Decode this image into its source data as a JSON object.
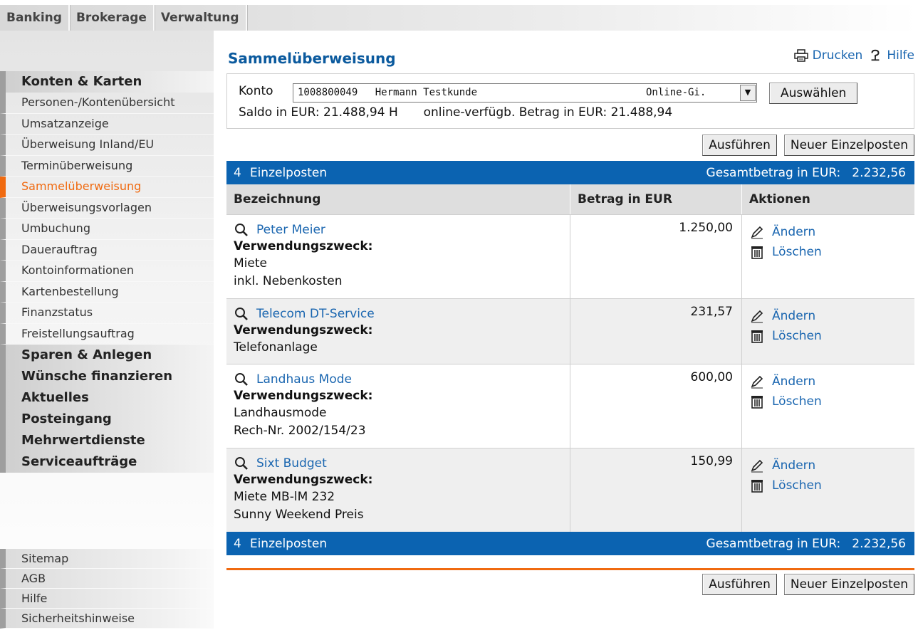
{
  "tabs": [
    {
      "label": "Banking"
    },
    {
      "label": "Brokerage"
    },
    {
      "label": "Verwaltung"
    }
  ],
  "sidebar": {
    "group1_title": "Konten & Karten",
    "items": [
      {
        "label": "Personen-/Kontenübersicht"
      },
      {
        "label": "Umsatzanzeige"
      },
      {
        "label": "Überweisung Inland/EU"
      },
      {
        "label": "Terminüberweisung"
      },
      {
        "label": "Sammelüberweisung"
      },
      {
        "label": "Überweisungsvorlagen"
      },
      {
        "label": "Umbuchung"
      },
      {
        "label": "Dauerauftrag"
      },
      {
        "label": "Kontoinformationen"
      },
      {
        "label": "Kartenbestellung"
      },
      {
        "label": "Finanzstatus"
      },
      {
        "label": "Freistellungsauftrag"
      }
    ],
    "groups": [
      {
        "label": "Sparen & Anlegen"
      },
      {
        "label": "Wünsche finanzieren"
      },
      {
        "label": "Aktuelles"
      },
      {
        "label": "Posteingang"
      },
      {
        "label": "Mehrwertdienste"
      },
      {
        "label": "Serviceaufträge"
      }
    ],
    "footer": [
      {
        "label": "Sitemap"
      },
      {
        "label": "AGB"
      },
      {
        "label": "Hilfe"
      },
      {
        "label": "Sicherheitshinweise"
      }
    ]
  },
  "page": {
    "title": "Sammelüberweisung",
    "print_label": "Drucken",
    "help_label": "Hilfe"
  },
  "konto": {
    "label": "Konto",
    "account_number": "1008800049",
    "account_holder": "Hermann Testkunde",
    "account_type": "Online-Gi.",
    "select_button": "Auswählen",
    "saldo_label": "Saldo in EUR:",
    "saldo_value": "21.488,94 H",
    "available_label": "online-verfügb. Betrag in EUR:",
    "available_value": "21.488,94"
  },
  "buttons": {
    "execute": "Ausführen",
    "new_item": "Neuer Einzelposten"
  },
  "summary": {
    "count": "4",
    "count_label": "Einzelposten",
    "total_label": "Gesamtbetrag in EUR:",
    "total_value": "2.232,56"
  },
  "table": {
    "headers": {
      "name": "Bezeichnung",
      "amount": "Betrag in EUR",
      "actions": "Aktionen"
    },
    "purpose_label": "Verwendungszweck:",
    "edit_label": "Ändern",
    "delete_label": "Löschen",
    "rows": [
      {
        "name": "Peter Meier",
        "amount": "1.250,00",
        "purpose": [
          "Miete",
          "inkl. Nebenkosten"
        ]
      },
      {
        "name": "Telecom DT-Service",
        "amount": "231,57",
        "purpose": [
          "Telefonanlage"
        ]
      },
      {
        "name": "Landhaus Mode",
        "amount": "600,00",
        "purpose": [
          "Landhausmode",
          "Rech-Nr. 2002/154/23"
        ]
      },
      {
        "name": "Sixt Budget",
        "amount": "150,99",
        "purpose": [
          "Miete MB-lM 232",
          "Sunny Weekend Preis"
        ]
      }
    ]
  },
  "colors": {
    "primary_blue": "#0b63b1",
    "link_blue": "#1a66b0",
    "active_orange": "#f06a10"
  }
}
